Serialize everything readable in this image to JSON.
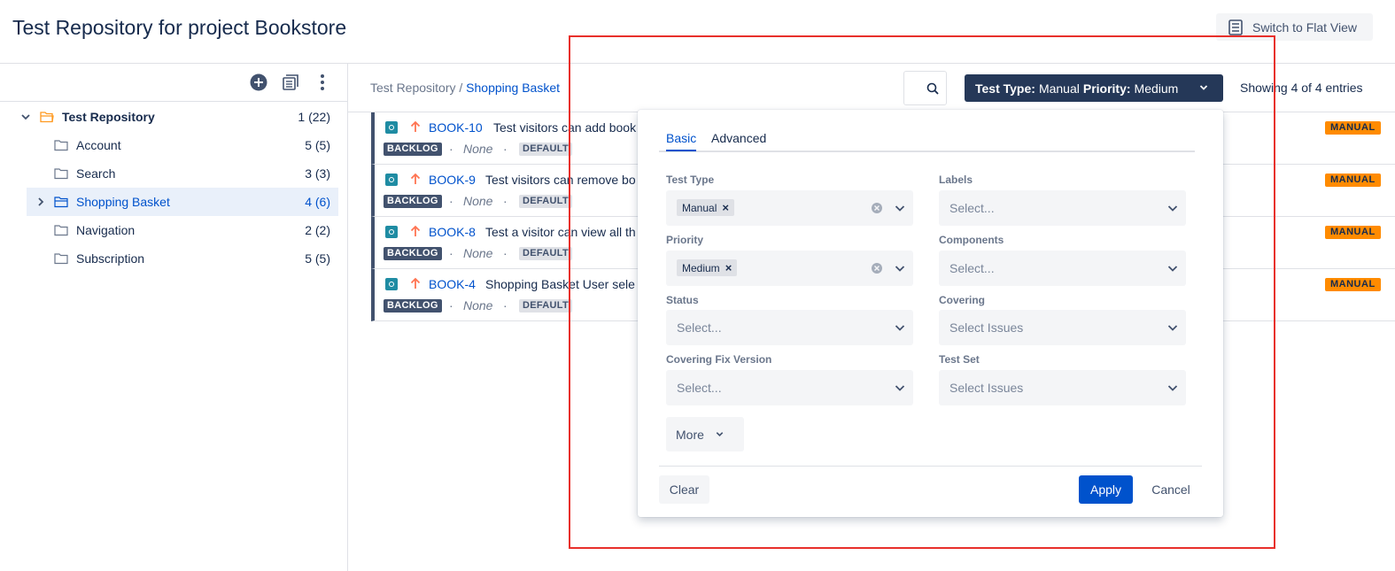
{
  "header": {
    "title": "Test Repository for project Bookstore",
    "flat_view_label": "Switch to Flat View"
  },
  "tree": {
    "root": {
      "label": "Test Repository",
      "count": "1 (22)"
    },
    "items": [
      {
        "label": "Account",
        "count": "5 (5)"
      },
      {
        "label": "Search",
        "count": "3 (3)"
      },
      {
        "label": "Shopping Basket",
        "count": "4 (6)"
      },
      {
        "label": "Navigation",
        "count": "2 (2)"
      },
      {
        "label": "Subscription",
        "count": "5 (5)"
      }
    ]
  },
  "breadcrumb": {
    "parent": "Test Repository",
    "separator": " / ",
    "current": "Shopping Basket"
  },
  "filter_button": {
    "type_label": "Test Type:",
    "type_value": "Manual",
    "priority_label": "Priority:",
    "priority_value": "Medium"
  },
  "showing": "Showing 4 of 4 entries",
  "tests": [
    {
      "key": "BOOK-10",
      "summary": "Test visitors can add book",
      "status": "BACKLOG",
      "none": "None",
      "env": "DEFAULT",
      "type": "MANUAL"
    },
    {
      "key": "BOOK-9",
      "summary": "Test visitors can remove bo",
      "status": "BACKLOG",
      "none": "None",
      "env": "DEFAULT",
      "type": "MANUAL"
    },
    {
      "key": "BOOK-8",
      "summary": "Test a visitor can view all th",
      "status": "BACKLOG",
      "none": "None",
      "env": "DEFAULT",
      "type": "MANUAL"
    },
    {
      "key": "BOOK-4",
      "summary": "Shopping Basket User sele",
      "status": "BACKLOG",
      "none": "None",
      "env": "DEFAULT",
      "type": "MANUAL"
    }
  ],
  "popup": {
    "tabs": [
      "Basic",
      "Advanced"
    ],
    "fields": {
      "test_type": {
        "label": "Test Type",
        "chip": "Manual"
      },
      "labels": {
        "label": "Labels",
        "placeholder": "Select..."
      },
      "priority": {
        "label": "Priority",
        "chip": "Medium"
      },
      "components": {
        "label": "Components",
        "placeholder": "Select..."
      },
      "status": {
        "label": "Status",
        "placeholder": "Select..."
      },
      "covering": {
        "label": "Covering",
        "placeholder": "Select Issues"
      },
      "covering_fix_version": {
        "label": "Covering Fix Version",
        "placeholder": "Select..."
      },
      "test_set": {
        "label": "Test Set",
        "placeholder": "Select Issues"
      }
    },
    "more_label": "More",
    "clear_label": "Clear",
    "apply_label": "Apply",
    "cancel_label": "Cancel"
  },
  "colors": {
    "accent": "#0052cc",
    "filter_button_bg": "#253858",
    "manual_badge": "#ff8b00",
    "highlight_box": "#e8302b"
  }
}
